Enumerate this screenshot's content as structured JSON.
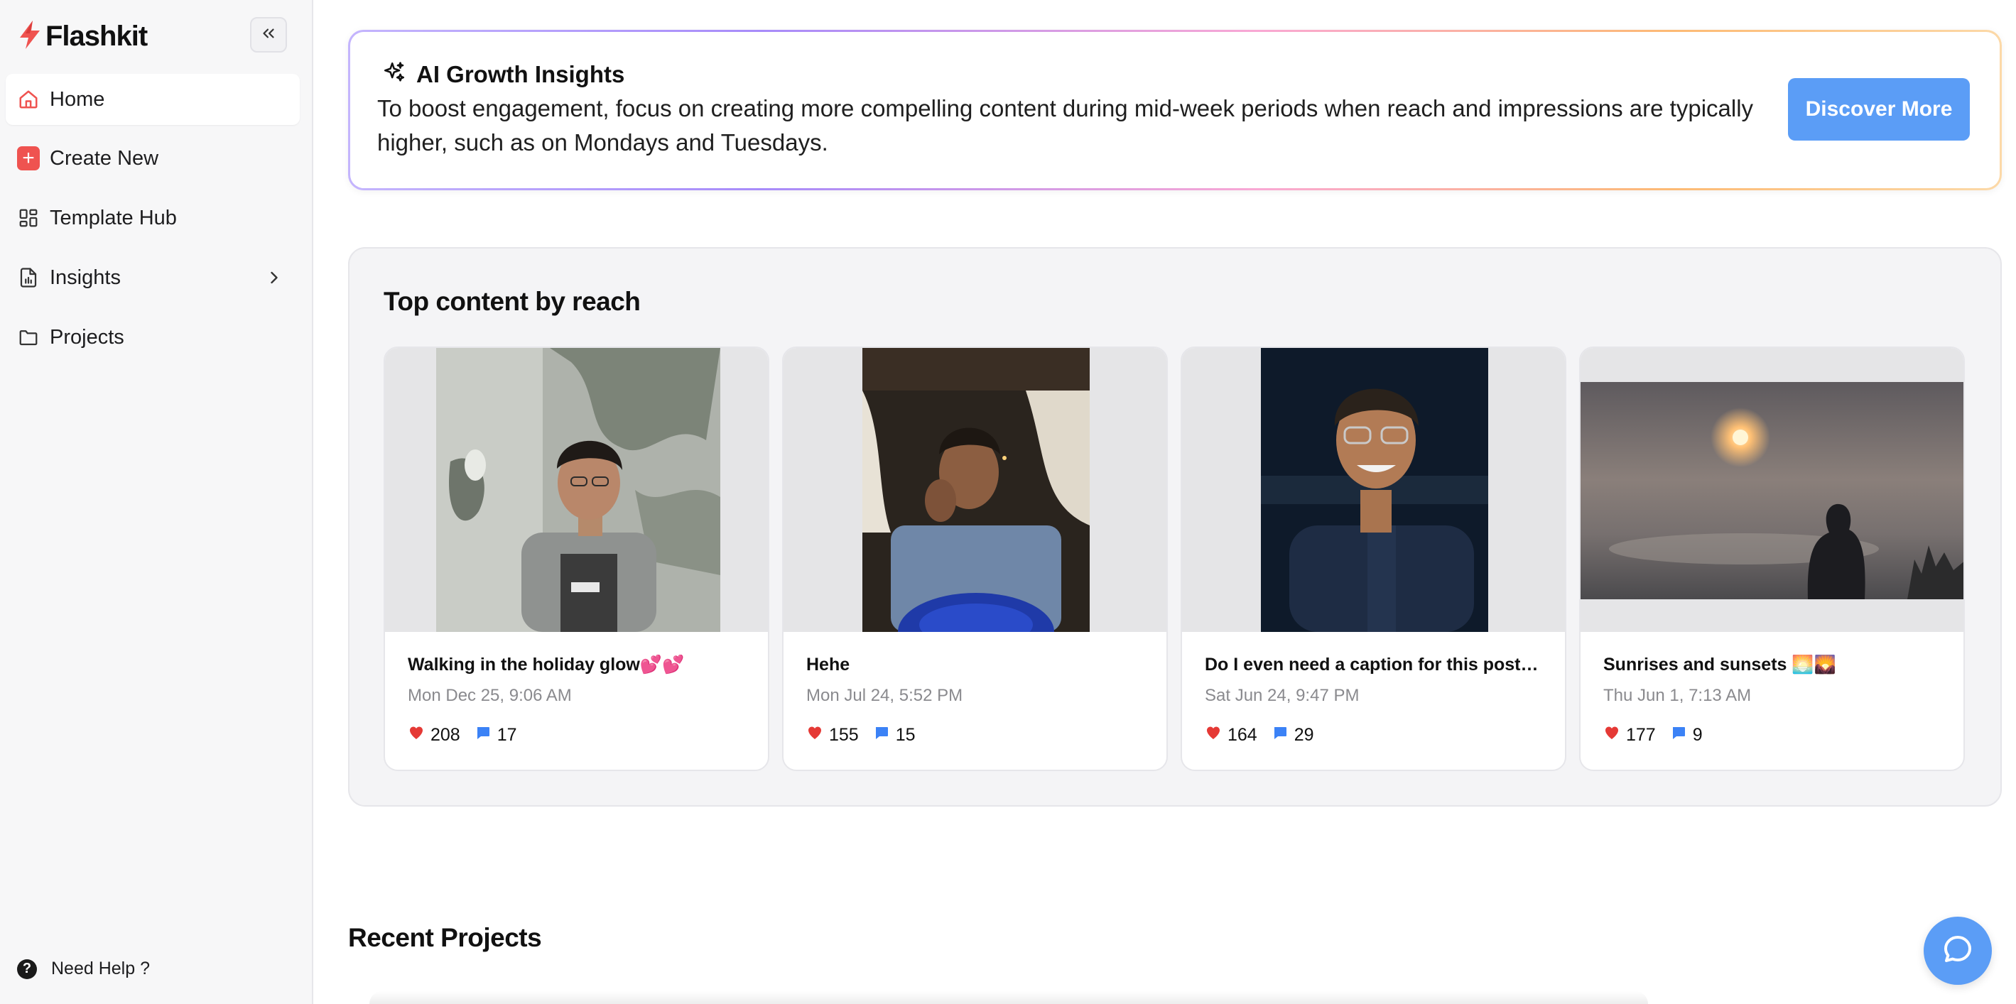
{
  "app": {
    "name": "Flashkit"
  },
  "sidebar": {
    "items": [
      {
        "label": "Home",
        "icon": "home-icon",
        "active": true
      },
      {
        "label": "Create New",
        "icon": "plus-square-icon"
      },
      {
        "label": "Template Hub",
        "icon": "grid-icon"
      },
      {
        "label": "Insights",
        "icon": "chart-file-icon",
        "has_submenu": true
      },
      {
        "label": "Projects",
        "icon": "folder-icon"
      }
    ],
    "help_label": "Need Help ?"
  },
  "insight": {
    "title": "AI Growth Insights",
    "body": "To boost engagement, focus on creating more compelling content during mid-week periods when reach and impressions are typically higher, such as on Mondays and Tuesdays.",
    "button_label": "Discover More"
  },
  "top_content": {
    "title": "Top content by reach",
    "posts": [
      {
        "caption": "Walking in the holiday glow💕💕",
        "date": "Mon Dec 25, 9:06 AM",
        "likes": "208",
        "comments": "17"
      },
      {
        "caption": "Hehe",
        "date": "Mon Jul 24, 5:52 PM",
        "likes": "155",
        "comments": "15"
      },
      {
        "caption": "Do I even need a caption for this post?...",
        "date": "Sat Jun 24, 9:47 PM",
        "likes": "164",
        "comments": "29"
      },
      {
        "caption": "Sunrises and sunsets 🌅🌄",
        "date": "Thu Jun 1, 7:13 AM",
        "likes": "177",
        "comments": "9"
      }
    ]
  },
  "recent_projects": {
    "title": "Recent Projects"
  },
  "colors": {
    "accent": "#5b9df6",
    "brand": "#ef5350",
    "heart": "#e53935",
    "comment": "#3b82f6"
  }
}
